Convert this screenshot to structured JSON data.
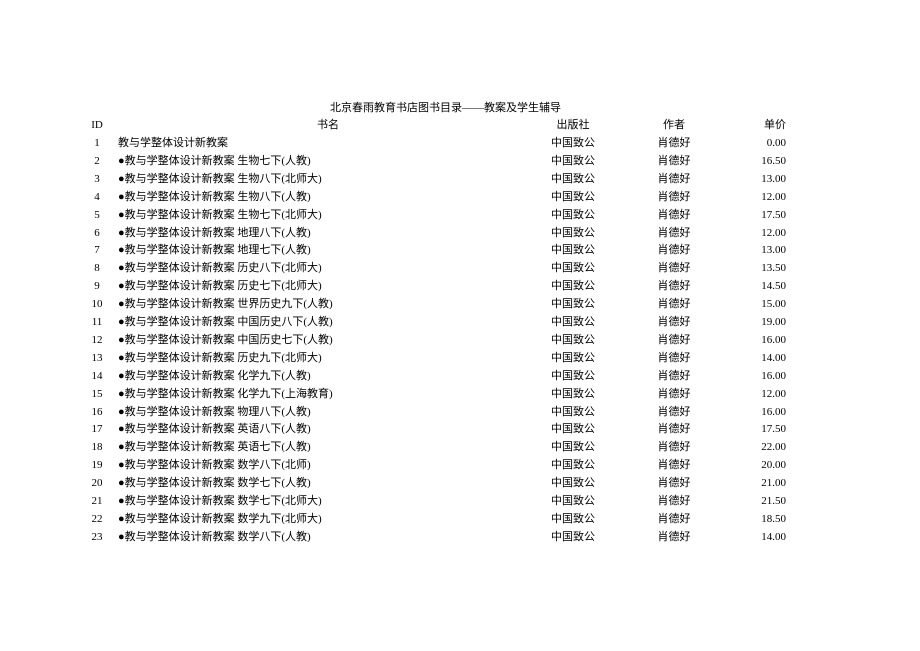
{
  "document": {
    "title": "北京春雨教育书店图书目录——教案及学生辅导"
  },
  "table": {
    "headers": {
      "id": "ID",
      "name": "书名",
      "publisher": "出版社",
      "author": "作者",
      "price": "单价"
    },
    "rows": [
      {
        "id": "1",
        "name": "教与学整体设计新教案",
        "publisher": "中国致公",
        "author": "肖德好",
        "price": "0.00"
      },
      {
        "id": "2",
        "name": "●教与学整体设计新教案  生物七下(人教)",
        "publisher": "中国致公",
        "author": "肖德好",
        "price": "16.50"
      },
      {
        "id": "3",
        "name": "●教与学整体设计新教案  生物八下(北师大)",
        "publisher": "中国致公",
        "author": "肖德好",
        "price": "13.00"
      },
      {
        "id": "4",
        "name": "●教与学整体设计新教案  生物八下(人教)",
        "publisher": "中国致公",
        "author": "肖德好",
        "price": "12.00"
      },
      {
        "id": "5",
        "name": "●教与学整体设计新教案  生物七下(北师大)",
        "publisher": "中国致公",
        "author": "肖德好",
        "price": "17.50"
      },
      {
        "id": "6",
        "name": "●教与学整体设计新教案  地理八下(人教)",
        "publisher": "中国致公",
        "author": "肖德好",
        "price": "12.00"
      },
      {
        "id": "7",
        "name": "●教与学整体设计新教案  地理七下(人教)",
        "publisher": "中国致公",
        "author": "肖德好",
        "price": "13.00"
      },
      {
        "id": "8",
        "name": "●教与学整体设计新教案  历史八下(北师大)",
        "publisher": "中国致公",
        "author": "肖德好",
        "price": "13.50"
      },
      {
        "id": "9",
        "name": "●教与学整体设计新教案  历史七下(北师大)",
        "publisher": "中国致公",
        "author": "肖德好",
        "price": "14.50"
      },
      {
        "id": "10",
        "name": "●教与学整体设计新教案  世界历史九下(人教)",
        "publisher": "中国致公",
        "author": "肖德好",
        "price": "15.00"
      },
      {
        "id": "11",
        "name": "●教与学整体设计新教案  中国历史八下(人教)",
        "publisher": "中国致公",
        "author": "肖德好",
        "price": "19.00"
      },
      {
        "id": "12",
        "name": "●教与学整体设计新教案  中国历史七下(人教)",
        "publisher": "中国致公",
        "author": "肖德好",
        "price": "16.00"
      },
      {
        "id": "13",
        "name": "●教与学整体设计新教案  历史九下(北师大)",
        "publisher": "中国致公",
        "author": "肖德好",
        "price": "14.00"
      },
      {
        "id": "14",
        "name": "●教与学整体设计新教案  化学九下(人教)",
        "publisher": "中国致公",
        "author": "肖德好",
        "price": "16.00"
      },
      {
        "id": "15",
        "name": "●教与学整体设计新教案  化学九下(上海教育)",
        "publisher": "中国致公",
        "author": "肖德好",
        "price": "12.00"
      },
      {
        "id": "16",
        "name": "●教与学整体设计新教案  物理八下(人教)",
        "publisher": "中国致公",
        "author": "肖德好",
        "price": "16.00"
      },
      {
        "id": "17",
        "name": "●教与学整体设计新教案  英语八下(人教)",
        "publisher": "中国致公",
        "author": "肖德好",
        "price": "17.50"
      },
      {
        "id": "18",
        "name": "●教与学整体设计新教案  英语七下(人教)",
        "publisher": "中国致公",
        "author": "肖德好",
        "price": "22.00"
      },
      {
        "id": "19",
        "name": "●教与学整体设计新教案  数学八下(北师)",
        "publisher": "中国致公",
        "author": "肖德好",
        "price": "20.00"
      },
      {
        "id": "20",
        "name": "●教与学整体设计新教案  数学七下(人教)",
        "publisher": "中国致公",
        "author": "肖德好",
        "price": "21.00"
      },
      {
        "id": "21",
        "name": "●教与学整体设计新教案  数学七下(北师大)",
        "publisher": "中国致公",
        "author": "肖德好",
        "price": "21.50"
      },
      {
        "id": "22",
        "name": "●教与学整体设计新教案  数学九下(北师大)",
        "publisher": "中国致公",
        "author": "肖德好",
        "price": "18.50"
      },
      {
        "id": "23",
        "name": "●教与学整体设计新教案  数学八下(人教)",
        "publisher": "中国致公",
        "author": "肖德好",
        "price": "14.00"
      }
    ]
  }
}
